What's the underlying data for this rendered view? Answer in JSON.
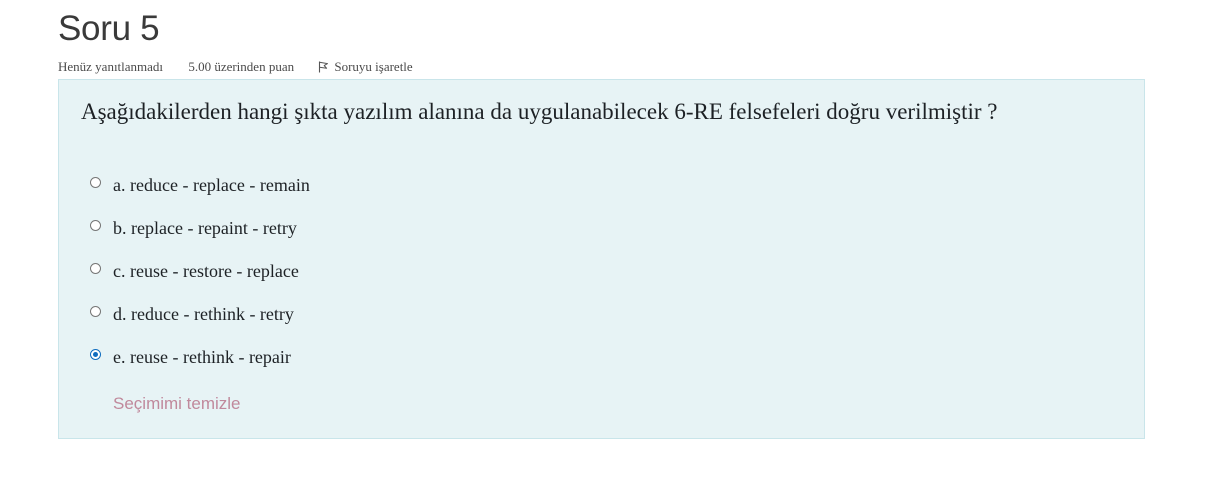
{
  "question": {
    "title": "Soru 5",
    "status": "Henüz yanıtlanmadı",
    "grade": "5.00 üzerinden puan",
    "flag_label": "Soruyu işaretle",
    "text": "Aşağıdakilerden hangi şıkta yazılım alanına da uygulanabilecek 6-RE felsefeleri doğru verilmiştir ?",
    "answers": [
      {
        "label": "a. reduce - replace - remain",
        "selected": false
      },
      {
        "label": "b. replace - repaint - retry",
        "selected": false
      },
      {
        "label": "c. reuse - restore - replace",
        "selected": false
      },
      {
        "label": "d. reduce - rethink - retry",
        "selected": false
      },
      {
        "label": "e. reuse - rethink - repair",
        "selected": true
      }
    ],
    "clear_choice_label": "Seçimimi temizle"
  },
  "colors": {
    "panel_bg": "#e7f3f5",
    "panel_border": "#c9e5ea",
    "radio_selected": "#0f6cbf",
    "clear_link": "#c0899c"
  },
  "icons": {
    "flag": "flag-icon"
  }
}
